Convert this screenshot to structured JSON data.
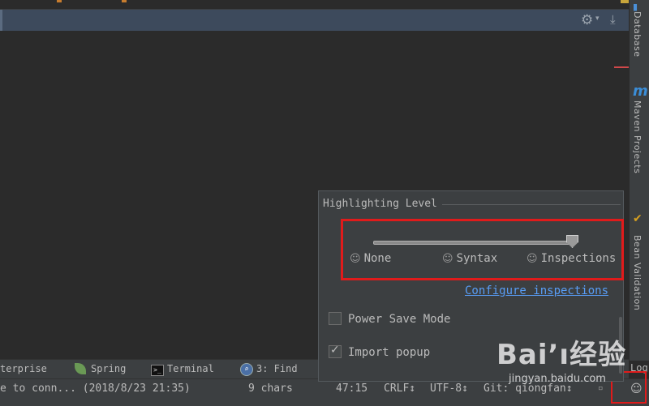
{
  "right_sidebar": {
    "tabs": [
      {
        "label": "Database",
        "icon": "database-icon"
      },
      {
        "label": "Maven Projects",
        "icon_glyph": "m",
        "icon": "maven-icon"
      },
      {
        "label": "Bean Validation",
        "icon": "bean-validation-icon"
      }
    ]
  },
  "bottom_tabs": [
    {
      "label": "terprise"
    },
    {
      "label": "Spring",
      "icon": "spring-leaf-icon"
    },
    {
      "label": "Terminal",
      "icon": "terminal-icon"
    },
    {
      "label": "3: Find",
      "icon": "find-icon"
    }
  ],
  "status_bar": {
    "message": "e to conn... (2018/8/23 21:35)",
    "selection": "9 chars",
    "position": "47:15",
    "line_sep": "CRLF↕",
    "encoding": "UTF-8↕",
    "vcs": "Git: qiongfan↕",
    "logs_label": "Log"
  },
  "popup": {
    "title": "Highlighting Level",
    "levels": [
      "None",
      "Syntax",
      "Inspections"
    ],
    "selected_level": "Inspections",
    "configure_link": "Configure inspections",
    "power_save": {
      "label": "Power Save Mode",
      "checked": false
    },
    "import_popup": {
      "label": "Import popup",
      "checked": true
    }
  },
  "watermark": {
    "brand": "Bai’ı经验",
    "url": "jingyan.baidu.com"
  },
  "colors": {
    "highlight_box": "#e01b1b",
    "link": "#589df6"
  }
}
